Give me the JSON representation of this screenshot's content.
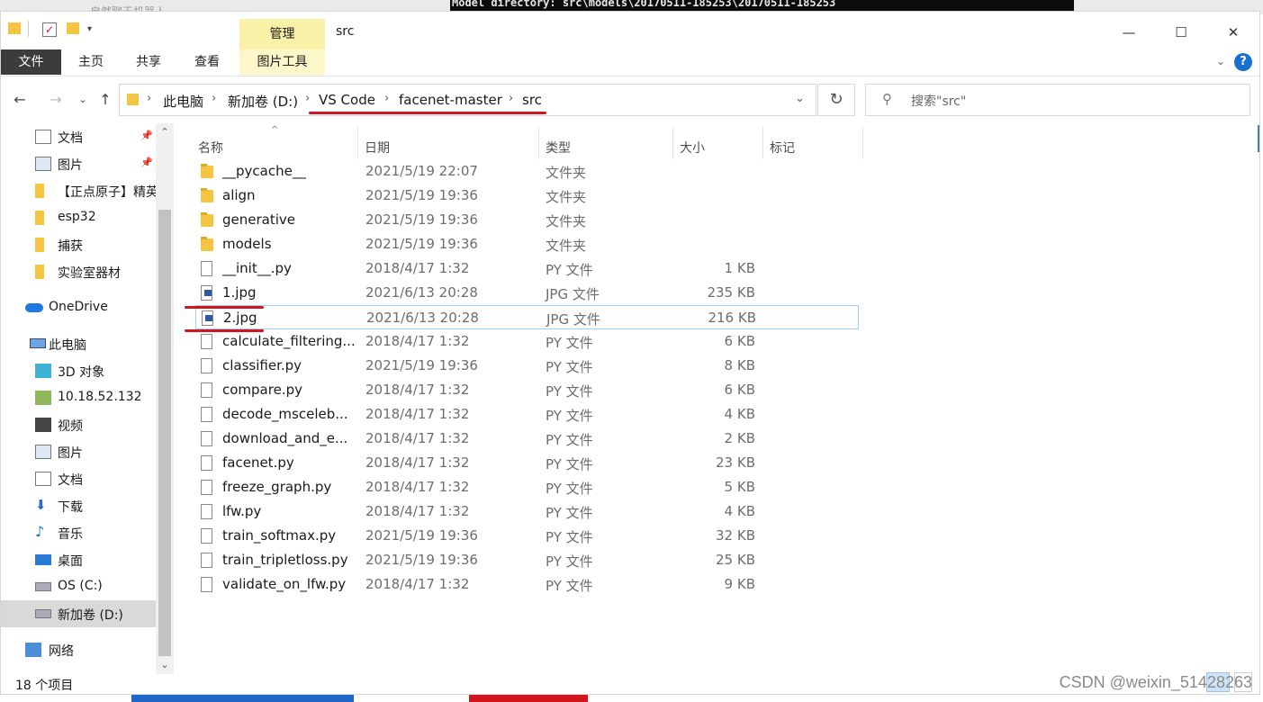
{
  "window": {
    "title": "src",
    "manage_tab": "管理",
    "minimize_icon": "minimize-icon",
    "maximize_icon": "maximize-icon",
    "close_icon": "close-icon"
  },
  "background": {
    "terminal_text": "Model directory: src\\models\\20170511-185253\\20170511-185253",
    "faint_text": "自然聊天机器人",
    "watermark": "CSDN @weixin_51428263"
  },
  "ribbon": {
    "tabs": [
      "文件",
      "主页",
      "共享",
      "查看",
      "图片工具"
    ]
  },
  "address": {
    "crumbs": [
      "此电脑",
      "新加卷 (D:)",
      "VS Code",
      "facenet-master",
      "src"
    ]
  },
  "search": {
    "placeholder": "搜索\"src\""
  },
  "nav_pane": {
    "items": [
      {
        "label": "文档",
        "icon": "document-icon",
        "pinned": true
      },
      {
        "label": "图片",
        "icon": "picture-icon",
        "pinned": true
      },
      {
        "label": "【正点原子】精英",
        "icon": "folder-icon",
        "pinned": false
      },
      {
        "label": "esp32",
        "icon": "folder-icon",
        "pinned": false
      },
      {
        "label": "捕获",
        "icon": "folder-icon",
        "pinned": false
      },
      {
        "label": "实验室器材",
        "icon": "folder-icon",
        "pinned": false
      },
      {
        "label": "OneDrive",
        "icon": "onedrive-icon",
        "pinned": false
      },
      {
        "label": "此电脑",
        "icon": "computer-icon",
        "pinned": false
      },
      {
        "label": "3D 对象",
        "icon": "3d-objects-icon",
        "pinned": false
      },
      {
        "label": "10.18.52.132",
        "icon": "network-drive-icon",
        "pinned": false
      },
      {
        "label": "视频",
        "icon": "video-icon",
        "pinned": false
      },
      {
        "label": "图片",
        "icon": "picture-icon",
        "pinned": false
      },
      {
        "label": "文档",
        "icon": "document-icon",
        "pinned": false
      },
      {
        "label": "下载",
        "icon": "download-icon",
        "pinned": false
      },
      {
        "label": "音乐",
        "icon": "music-icon",
        "pinned": false
      },
      {
        "label": "桌面",
        "icon": "desktop-icon",
        "pinned": false
      },
      {
        "label": "OS (C:)",
        "icon": "drive-icon",
        "pinned": false
      },
      {
        "label": "新加卷 (D:)",
        "icon": "drive-icon",
        "pinned": false
      },
      {
        "label": "网络",
        "icon": "network-icon",
        "pinned": false
      }
    ]
  },
  "columns": [
    "名称",
    "日期",
    "类型",
    "大小",
    "标记"
  ],
  "files": [
    {
      "name": "__pycache__",
      "date": "2021/5/19 22:07",
      "type": "文件夹",
      "size": "",
      "kind": "folder"
    },
    {
      "name": "align",
      "date": "2021/5/19 19:36",
      "type": "文件夹",
      "size": "",
      "kind": "folder"
    },
    {
      "name": "generative",
      "date": "2021/5/19 19:36",
      "type": "文件夹",
      "size": "",
      "kind": "folder"
    },
    {
      "name": "models",
      "date": "2021/5/19 19:36",
      "type": "文件夹",
      "size": "",
      "kind": "folder"
    },
    {
      "name": "__init__.py",
      "date": "2018/4/17 1:32",
      "type": "PY 文件",
      "size": "1 KB",
      "kind": "doc"
    },
    {
      "name": "1.jpg",
      "date": "2021/6/13 20:28",
      "type": "JPG 文件",
      "size": "235 KB",
      "kind": "img"
    },
    {
      "name": "2.jpg",
      "date": "2021/6/13 20:28",
      "type": "JPG 文件",
      "size": "216 KB",
      "kind": "img"
    },
    {
      "name": "calculate_filtering...",
      "date": "2018/4/17 1:32",
      "type": "PY 文件",
      "size": "6 KB",
      "kind": "doc"
    },
    {
      "name": "classifier.py",
      "date": "2021/5/19 19:36",
      "type": "PY 文件",
      "size": "8 KB",
      "kind": "doc"
    },
    {
      "name": "compare.py",
      "date": "2018/4/17 1:32",
      "type": "PY 文件",
      "size": "6 KB",
      "kind": "doc"
    },
    {
      "name": "decode_msceleb...",
      "date": "2018/4/17 1:32",
      "type": "PY 文件",
      "size": "4 KB",
      "kind": "doc"
    },
    {
      "name": "download_and_e...",
      "date": "2018/4/17 1:32",
      "type": "PY 文件",
      "size": "2 KB",
      "kind": "doc"
    },
    {
      "name": "facenet.py",
      "date": "2018/4/17 1:32",
      "type": "PY 文件",
      "size": "23 KB",
      "kind": "doc"
    },
    {
      "name": "freeze_graph.py",
      "date": "2018/4/17 1:32",
      "type": "PY 文件",
      "size": "5 KB",
      "kind": "doc"
    },
    {
      "name": "lfw.py",
      "date": "2018/4/17 1:32",
      "type": "PY 文件",
      "size": "4 KB",
      "kind": "doc"
    },
    {
      "name": "train_softmax.py",
      "date": "2021/5/19 19:36",
      "type": "PY 文件",
      "size": "32 KB",
      "kind": "doc"
    },
    {
      "name": "train_tripletloss.py",
      "date": "2021/5/19 19:36",
      "type": "PY 文件",
      "size": "25 KB",
      "kind": "doc"
    },
    {
      "name": "validate_on_lfw.py",
      "date": "2018/4/17 1:32",
      "type": "PY 文件",
      "size": "9 KB",
      "kind": "doc"
    }
  ],
  "selected_file": "2.jpg",
  "status": {
    "item_count": "18 个项目"
  },
  "colors": {
    "accent": "#0078d7",
    "selection_border": "#99d1ff",
    "annotation": "#d0161c",
    "manage_tab": "#faf1a8"
  }
}
